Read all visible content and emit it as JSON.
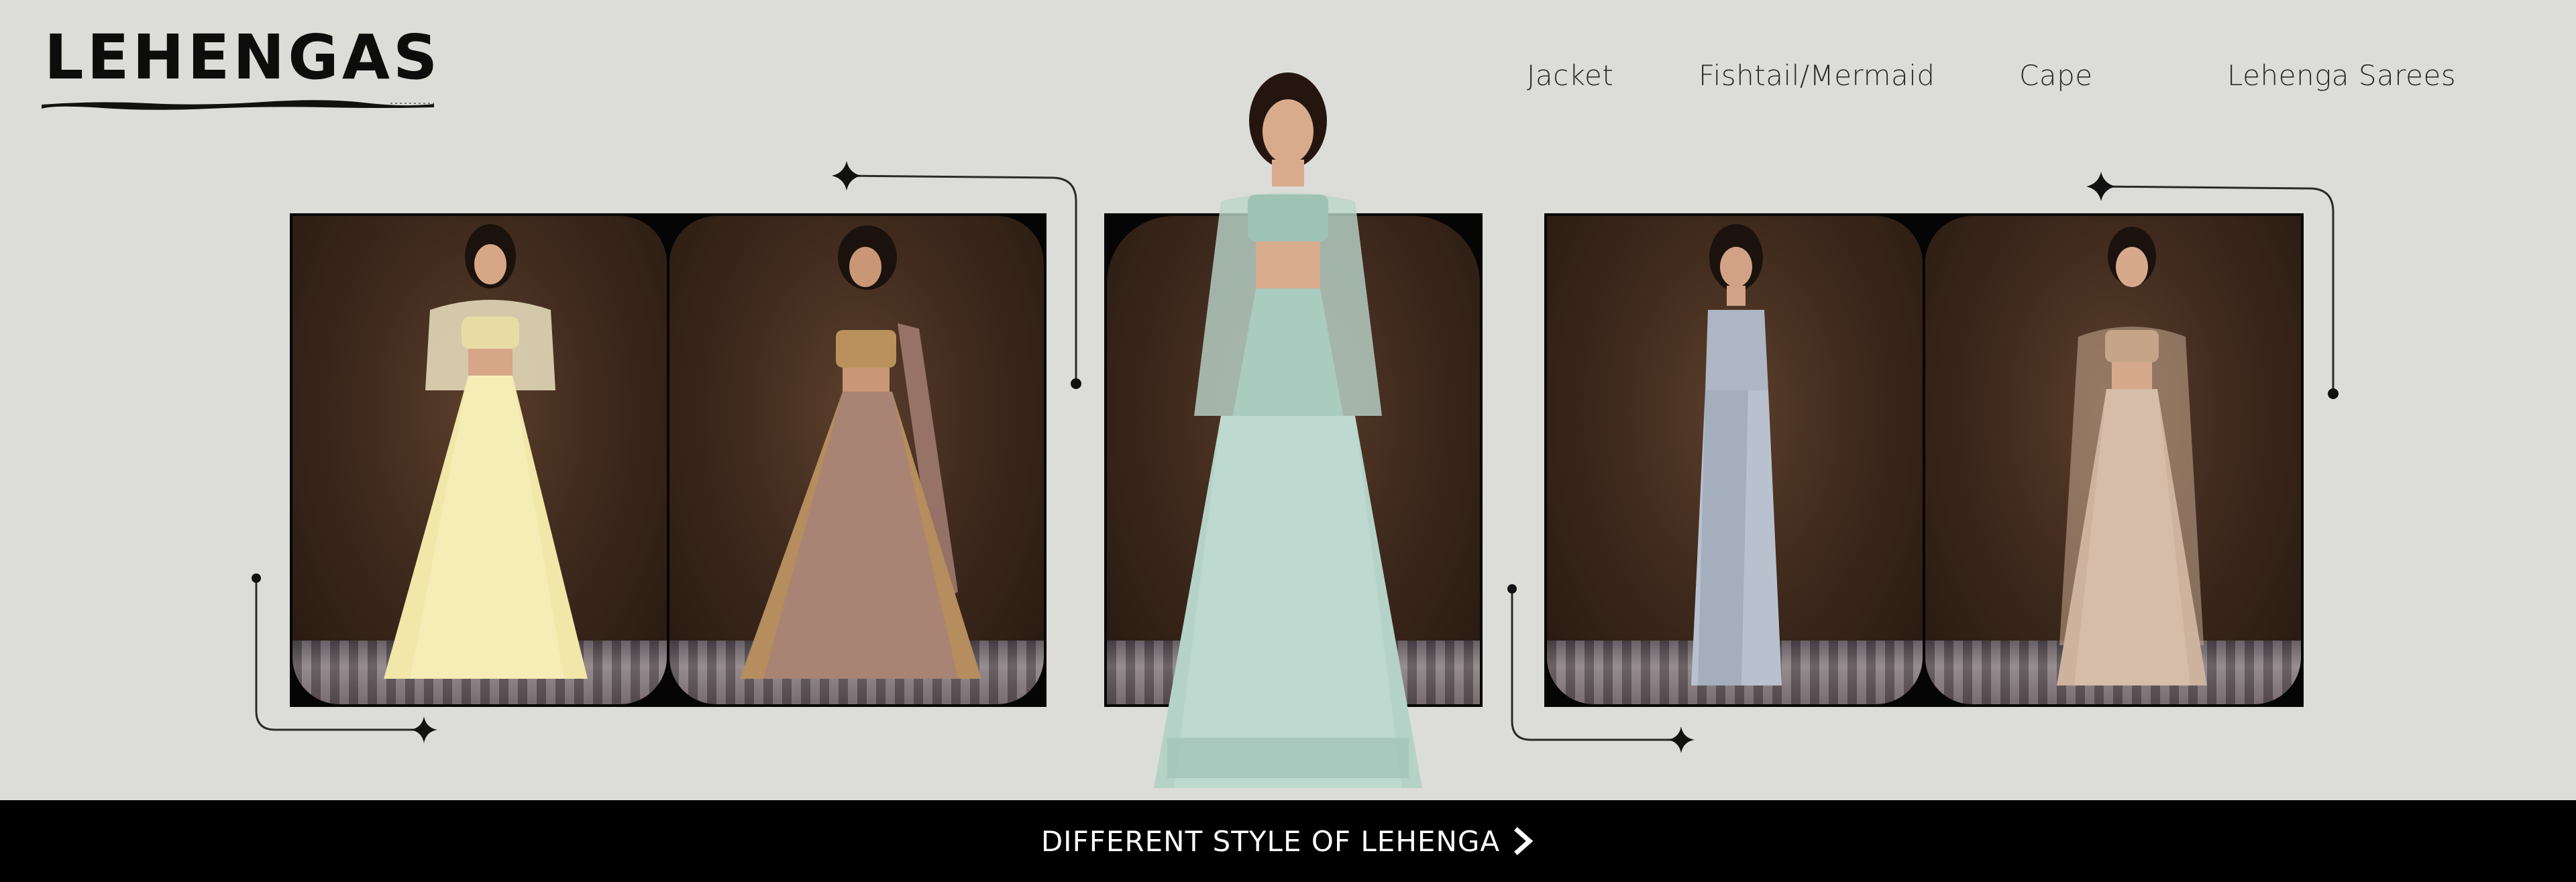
{
  "header": {
    "brand": "LEHENGAS",
    "nav": [
      {
        "label": "Jacket"
      },
      {
        "label": "Fishtail/Mermaid"
      },
      {
        "label": "Cape"
      },
      {
        "label": "Lehenga Sarees"
      }
    ]
  },
  "banner": {
    "label": "DIFFERENT STYLE OF LEHENGA",
    "icon": "chevron-right-icon"
  },
  "colors": {
    "background": "#dcddd8",
    "banner": "#000000",
    "banner_text": "#ffffff",
    "backdrop": "#3f2a1d"
  },
  "gallery": [
    {
      "name": "jacket-lehenga-photo",
      "outfit": "yellow"
    },
    {
      "name": "printed-lehenga-photo",
      "outfit": "gold-mauve"
    },
    {
      "name": "featured-lehenga-photo",
      "outfit": "mint"
    },
    {
      "name": "mermaid-lehenga-photo",
      "outfit": "silver"
    },
    {
      "name": "cape-lehenga-photo",
      "outfit": "champagne"
    }
  ]
}
